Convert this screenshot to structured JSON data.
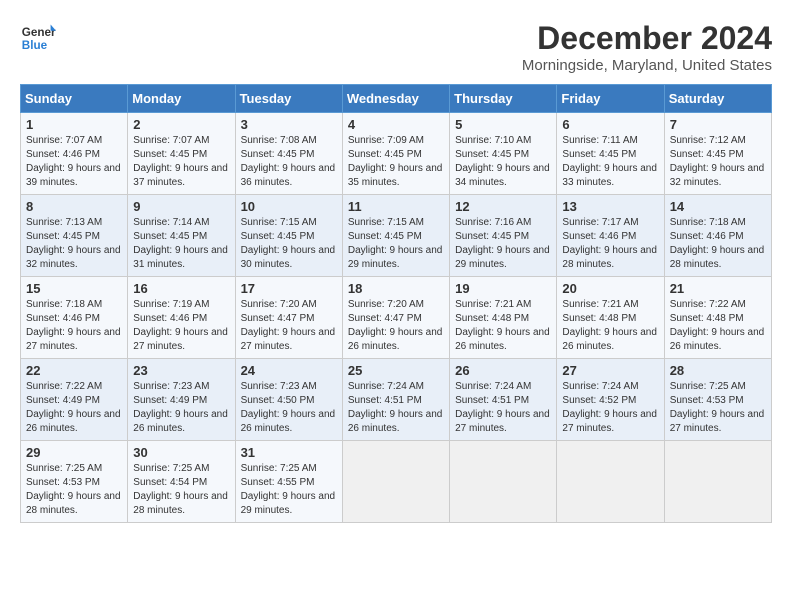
{
  "logo": {
    "line1": "General",
    "line2": "Blue"
  },
  "title": "December 2024",
  "location": "Morningside, Maryland, United States",
  "days_of_week": [
    "Sunday",
    "Monday",
    "Tuesday",
    "Wednesday",
    "Thursday",
    "Friday",
    "Saturday"
  ],
  "weeks": [
    [
      {
        "day": "1",
        "sunrise": "7:07 AM",
        "sunset": "4:46 PM",
        "daylight": "9 hours and 39 minutes."
      },
      {
        "day": "2",
        "sunrise": "7:07 AM",
        "sunset": "4:45 PM",
        "daylight": "9 hours and 37 minutes."
      },
      {
        "day": "3",
        "sunrise": "7:08 AM",
        "sunset": "4:45 PM",
        "daylight": "9 hours and 36 minutes."
      },
      {
        "day": "4",
        "sunrise": "7:09 AM",
        "sunset": "4:45 PM",
        "daylight": "9 hours and 35 minutes."
      },
      {
        "day": "5",
        "sunrise": "7:10 AM",
        "sunset": "4:45 PM",
        "daylight": "9 hours and 34 minutes."
      },
      {
        "day": "6",
        "sunrise": "7:11 AM",
        "sunset": "4:45 PM",
        "daylight": "9 hours and 33 minutes."
      },
      {
        "day": "7",
        "sunrise": "7:12 AM",
        "sunset": "4:45 PM",
        "daylight": "9 hours and 32 minutes."
      }
    ],
    [
      {
        "day": "8",
        "sunrise": "7:13 AM",
        "sunset": "4:45 PM",
        "daylight": "9 hours and 32 minutes."
      },
      {
        "day": "9",
        "sunrise": "7:14 AM",
        "sunset": "4:45 PM",
        "daylight": "9 hours and 31 minutes."
      },
      {
        "day": "10",
        "sunrise": "7:15 AM",
        "sunset": "4:45 PM",
        "daylight": "9 hours and 30 minutes."
      },
      {
        "day": "11",
        "sunrise": "7:15 AM",
        "sunset": "4:45 PM",
        "daylight": "9 hours and 29 minutes."
      },
      {
        "day": "12",
        "sunrise": "7:16 AM",
        "sunset": "4:45 PM",
        "daylight": "9 hours and 29 minutes."
      },
      {
        "day": "13",
        "sunrise": "7:17 AM",
        "sunset": "4:46 PM",
        "daylight": "9 hours and 28 minutes."
      },
      {
        "day": "14",
        "sunrise": "7:18 AM",
        "sunset": "4:46 PM",
        "daylight": "9 hours and 28 minutes."
      }
    ],
    [
      {
        "day": "15",
        "sunrise": "7:18 AM",
        "sunset": "4:46 PM",
        "daylight": "9 hours and 27 minutes."
      },
      {
        "day": "16",
        "sunrise": "7:19 AM",
        "sunset": "4:46 PM",
        "daylight": "9 hours and 27 minutes."
      },
      {
        "day": "17",
        "sunrise": "7:20 AM",
        "sunset": "4:47 PM",
        "daylight": "9 hours and 27 minutes."
      },
      {
        "day": "18",
        "sunrise": "7:20 AM",
        "sunset": "4:47 PM",
        "daylight": "9 hours and 26 minutes."
      },
      {
        "day": "19",
        "sunrise": "7:21 AM",
        "sunset": "4:48 PM",
        "daylight": "9 hours and 26 minutes."
      },
      {
        "day": "20",
        "sunrise": "7:21 AM",
        "sunset": "4:48 PM",
        "daylight": "9 hours and 26 minutes."
      },
      {
        "day": "21",
        "sunrise": "7:22 AM",
        "sunset": "4:48 PM",
        "daylight": "9 hours and 26 minutes."
      }
    ],
    [
      {
        "day": "22",
        "sunrise": "7:22 AM",
        "sunset": "4:49 PM",
        "daylight": "9 hours and 26 minutes."
      },
      {
        "day": "23",
        "sunrise": "7:23 AM",
        "sunset": "4:49 PM",
        "daylight": "9 hours and 26 minutes."
      },
      {
        "day": "24",
        "sunrise": "7:23 AM",
        "sunset": "4:50 PM",
        "daylight": "9 hours and 26 minutes."
      },
      {
        "day": "25",
        "sunrise": "7:24 AM",
        "sunset": "4:51 PM",
        "daylight": "9 hours and 26 minutes."
      },
      {
        "day": "26",
        "sunrise": "7:24 AM",
        "sunset": "4:51 PM",
        "daylight": "9 hours and 27 minutes."
      },
      {
        "day": "27",
        "sunrise": "7:24 AM",
        "sunset": "4:52 PM",
        "daylight": "9 hours and 27 minutes."
      },
      {
        "day": "28",
        "sunrise": "7:25 AM",
        "sunset": "4:53 PM",
        "daylight": "9 hours and 27 minutes."
      }
    ],
    [
      {
        "day": "29",
        "sunrise": "7:25 AM",
        "sunset": "4:53 PM",
        "daylight": "9 hours and 28 minutes."
      },
      {
        "day": "30",
        "sunrise": "7:25 AM",
        "sunset": "4:54 PM",
        "daylight": "9 hours and 28 minutes."
      },
      {
        "day": "31",
        "sunrise": "7:25 AM",
        "sunset": "4:55 PM",
        "daylight": "9 hours and 29 minutes."
      },
      null,
      null,
      null,
      null
    ]
  ]
}
